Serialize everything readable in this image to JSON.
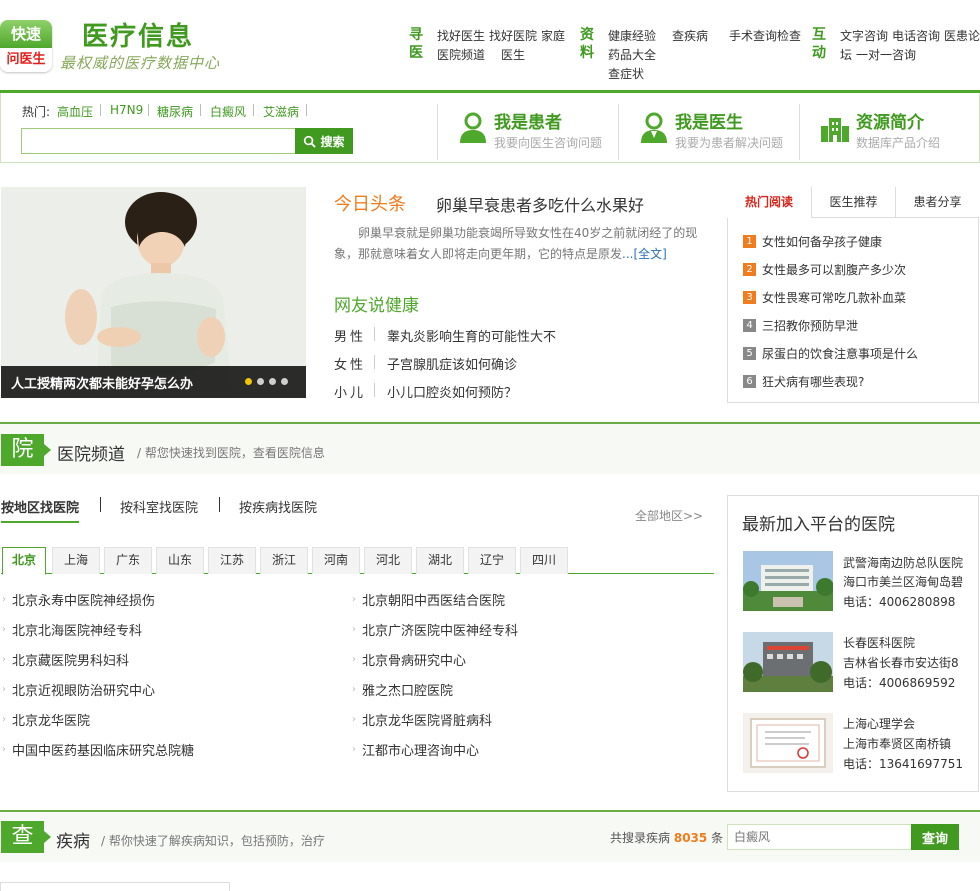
{
  "logo": {
    "line1": "快速",
    "line2": "问医生"
  },
  "site": {
    "title": "医疗信息",
    "slogan": "最权威的医疗数据中心"
  },
  "nav": {
    "seek": {
      "label": "寻医",
      "links": [
        "找好医生",
        "找好医院",
        "家庭",
        "医院频道",
        "医生"
      ]
    },
    "data": {
      "label": "资料",
      "links": [
        "健康经验",
        "查疾病",
        "手术查询检查",
        "药品大全",
        "查症状"
      ]
    },
    "interact": {
      "label": "互动",
      "links": [
        "文字咨询",
        "电话咨询",
        "医患论",
        "坛",
        "一对一咨询"
      ]
    }
  },
  "search": {
    "hot_label": "热门:",
    "hot_words": [
      "高血压",
      "H7N9",
      "糖尿病",
      "白癜风",
      "艾滋病"
    ],
    "button_label": "搜索",
    "placeholder": ""
  },
  "roles": [
    {
      "title": "我是患者",
      "sub": "我要向医生咨询问题",
      "icon": "patient-icon"
    },
    {
      "title": "我是医生",
      "sub": "我要为患者解决问题",
      "icon": "doctor-icon"
    },
    {
      "title": "资源简介",
      "sub": "数据库产品介绍",
      "icon": "building-icon"
    }
  ],
  "feature": {
    "caption": "人工授精两次都未能好孕怎么办",
    "active_slide": 1,
    "slide_count": 4
  },
  "today": {
    "label": "今日头条",
    "headline": "卵巢早衰患者多吃什么水果好",
    "summary": "卵巢早衰就是卵巢功能衰竭所导致女性在40岁之前就闭经了的现象，那就意味着女人即将走向更年期，它的特点是原发",
    "more_label": "...[全文]"
  },
  "forum": {
    "label": "网友说健康",
    "items": [
      {
        "cat": "男性",
        "q": "睾丸炎影响生育的可能性大不"
      },
      {
        "cat": "女性",
        "q": "子宫腺肌症该如何确诊"
      },
      {
        "cat": "小儿",
        "q": "小儿口腔炎如何预防？"
      }
    ]
  },
  "hot_tabs": {
    "tabs": [
      "热门阅读",
      "医生推荐",
      "患者分享"
    ],
    "items": [
      "女性如何备孕孩子健康",
      "女性最多可以割腹产多少次",
      "女性畏寒可常吃几款补血菜",
      "三招教你预防早泄",
      "尿蛋白的饮食注意事项是什么",
      "狂犬病有哪些表现?"
    ],
    "ranks": [
      "1",
      "2",
      "3",
      "4",
      "5",
      "6"
    ]
  },
  "hospital_section": {
    "badge": "院",
    "title": "医院频道",
    "desc": "/ 帮您快速找到医院，查看医院信息",
    "categories": [
      "按地区找医院",
      "按科室找医院",
      "按疾病找医院"
    ],
    "all_regions": "全部地区>>",
    "regions": [
      "北京",
      "上海",
      "广东",
      "山东",
      "江苏",
      "浙江",
      "河南",
      "河北",
      "湖北",
      "辽宁",
      "四川"
    ],
    "hospitals_left": [
      "北京永寿中医院神经损伤",
      "北京北海医院神经专科",
      "北京藏医院男科妇科",
      "北京近视眼防治研究中心",
      "北京龙华医院",
      "中国中医药基因临床研究总院糖"
    ],
    "hospitals_right": [
      "北京朝阳中西医结合医院",
      "北京广济医院中医神经专科",
      "北京骨病研究中心",
      "雅之杰口腔医院",
      "北京龙华医院肾脏病科",
      "江都市心理咨询中心"
    ]
  },
  "new_hospitals": {
    "title": "最新加入平台的医院",
    "items": [
      {
        "name": "武警海南边防总队医院",
        "addr": "海口市美兰区海甸岛碧",
        "tel": "电话：4006280898"
      },
      {
        "name": "长春医科医院",
        "addr": "吉林省长春市安达街8",
        "tel": "电话：4006869592"
      },
      {
        "name": "上海心理学会",
        "addr": "上海市奉贤区南桥镇",
        "tel": "电话：13641697751"
      }
    ]
  },
  "disease_section": {
    "badge": "查",
    "title": "疾病",
    "desc": "/ 帮你快速了解疾病知识，包括预防，治疗",
    "count_prefix": "共搜录疾病",
    "count": "8035",
    "count_suffix": "条",
    "placeholder": "白癜风",
    "button_label": "查询"
  },
  "colors": {
    "brand_green": "#4ea82c",
    "accent_orange": "#f07c1e",
    "hot_red": "#d8261c"
  }
}
